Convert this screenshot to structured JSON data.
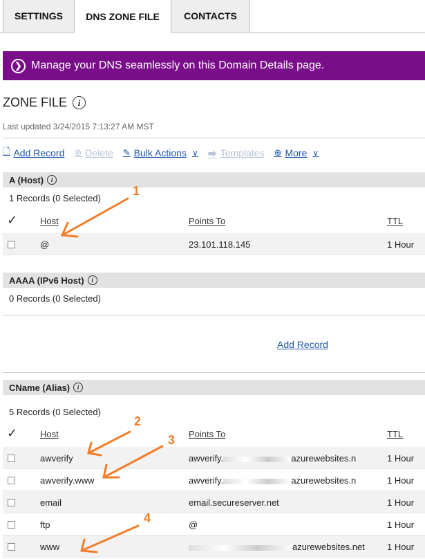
{
  "tabs": [
    "SETTINGS",
    "DNS ZONE FILE",
    "CONTACTS"
  ],
  "banner": {
    "icon": "chevron-right-circle-icon",
    "text": "Manage your DNS seamlessly on this Domain Details page."
  },
  "zone": {
    "title": "ZONE FILE",
    "last_updated": "Last updated 3/24/2015 7:13:27 AM MST"
  },
  "toolbar": {
    "add_record": "Add Record",
    "delete": "Delete",
    "bulk_actions": "Bulk Actions",
    "templates": "Templates",
    "more": "More"
  },
  "columns": {
    "host": "Host",
    "points_to": "Points To",
    "ttl": "TTL"
  },
  "a_host": {
    "title": "A (Host)",
    "count": "1 Records (0 Selected)",
    "rows": [
      {
        "host": "@",
        "points_to": "23.101.118.145",
        "ttl": "1 Hour"
      }
    ]
  },
  "aaaa": {
    "title": "AAAA (IPv6 Host)",
    "count": "0 Records (0 Selected)",
    "add_record": "Add Record"
  },
  "cname": {
    "title": "CName (Alias)",
    "count": "5 Records (0 Selected)",
    "rows": [
      {
        "host": "awverify",
        "points_to_pre": "awverify.",
        "points_to_post": "azurewebsites.n",
        "ttl": "1 Hour"
      },
      {
        "host": "awverify.www",
        "points_to_pre": "awverify.",
        "points_to_post": "azurewebsites.n",
        "ttl": "1 Hour"
      },
      {
        "host": "email",
        "points_to_pre": "email.secureserver.net",
        "points_to_post": "",
        "ttl": "1 Hour"
      },
      {
        "host": "ftp",
        "points_to_pre": "@",
        "points_to_post": "",
        "ttl": "1 Hour"
      },
      {
        "host": "www",
        "points_to_pre": "",
        "points_to_post": "azurewebsites.net",
        "ttl": "1 Hour"
      }
    ]
  },
  "annotations": [
    "1",
    "2",
    "3",
    "4"
  ],
  "colors": {
    "banner": "#7a0d8a",
    "link": "#1a56a8",
    "arrow": "#f07e2a"
  }
}
